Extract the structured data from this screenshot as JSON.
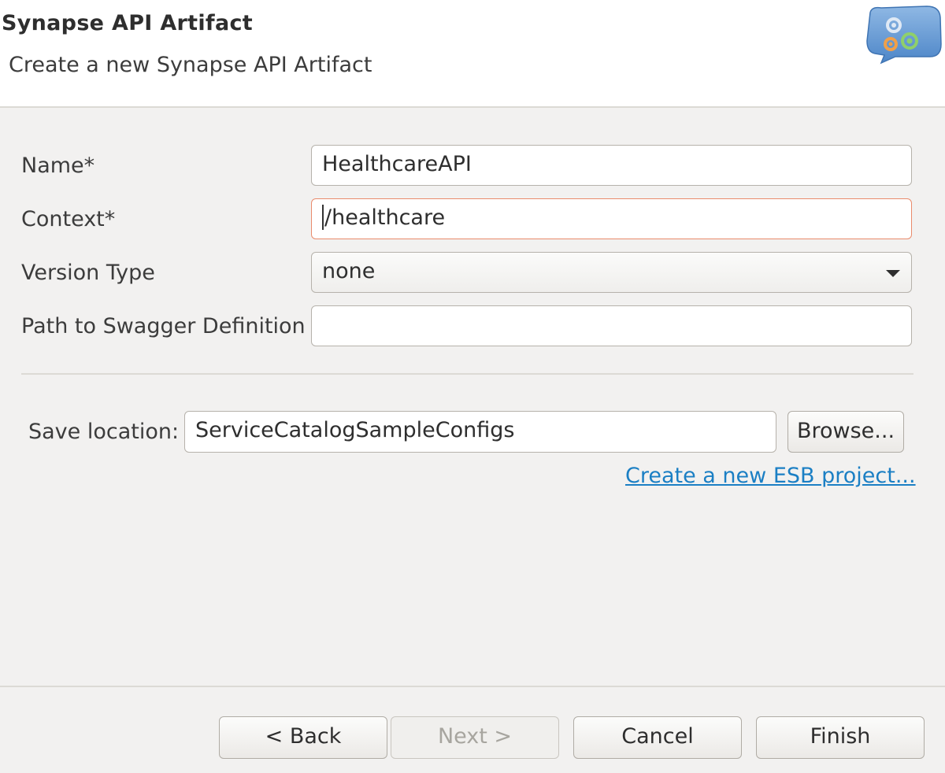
{
  "banner": {
    "title": "Synapse API Artifact",
    "subtitle": "Create a new Synapse API Artifact",
    "icon": "gears-icon"
  },
  "form": {
    "name_label": "Name*",
    "name_value": "HealthcareAPI",
    "context_label": "Context*",
    "context_value": "/healthcare",
    "version_type_label": "Version Type",
    "version_type_value": "none",
    "swagger_label": "Path to Swagger Definition",
    "swagger_value": ""
  },
  "location": {
    "label": "Save location:",
    "value": "ServiceCatalogSampleConfigs",
    "browse_label": "Browse...",
    "new_project_link": "Create a new ESB project..."
  },
  "buttons": {
    "back": "< Back",
    "next": "Next >",
    "cancel": "Cancel",
    "finish": "Finish"
  },
  "colors": {
    "accent_focus": "#e98b6c",
    "link": "#1b7fc4",
    "background": "#f2f1f0"
  }
}
